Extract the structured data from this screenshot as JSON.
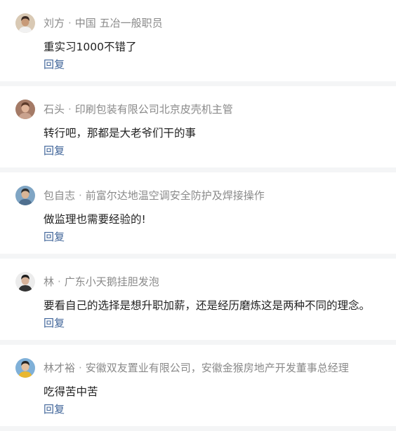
{
  "separator": "·",
  "comments": [
    {
      "author": "刘方",
      "title": "中国 五冶一般职员",
      "text": "重实习1000不错了",
      "reply_label": "回复",
      "avatar_icon": "user-avatar-icon",
      "avatar_colors": {
        "bg": "#d9c9b4",
        "skin": "#c79a78",
        "hair": "#3b2a22",
        "cloth": "#f1f1f1"
      }
    },
    {
      "author": "石头",
      "title": "印刷包装有限公司北京皮壳机主管",
      "text": "转行吧，那都是大老爷们干的事",
      "reply_label": "回复",
      "avatar_icon": "user-avatar-icon",
      "avatar_colors": {
        "bg": "#a47a66",
        "skin": "#e0b59a",
        "hair": "#5b3a2a",
        "cloth": "#c9a28e"
      }
    },
    {
      "author": "包自志",
      "title": "前富尔达地温空调安全防护及焊接操作",
      "text": "做监理也需要经验的!",
      "reply_label": "回复",
      "avatar_icon": "user-avatar-icon",
      "avatar_colors": {
        "bg": "#7fa5c4",
        "skin": "#d9b596",
        "hair": "#2e2e2e",
        "cloth": "#4f6f8f"
      }
    },
    {
      "author": "林",
      "title": "广东小天鹅挂胆发泡",
      "text": "要看自己的选择是想升职加薪，还是经历磨炼这是两种不同的理念。",
      "reply_label": "回复",
      "avatar_icon": "user-avatar-icon",
      "avatar_colors": {
        "bg": "#ececec",
        "skin": "#d7b39a",
        "hair": "#1c1c1c",
        "cloth": "#333333"
      }
    },
    {
      "author": "林才裕",
      "title": "安徽双友置业有限公司，安徽金猴房地产开发董事总经理",
      "text": "吃得苦中苦",
      "reply_label": "回复",
      "avatar_icon": "user-avatar-icon",
      "avatar_colors": {
        "bg": "#7fb0d8",
        "skin": "#e4c09e",
        "hair": "#242424",
        "cloth": "#e8b730"
      }
    }
  ]
}
